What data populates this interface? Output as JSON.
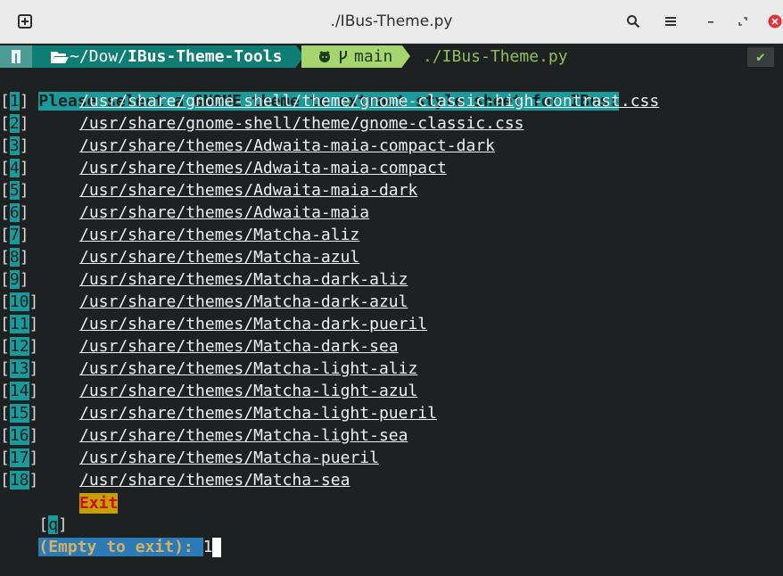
{
  "window": {
    "title": "./IBus-Theme.py",
    "new_tab_icon": "new-tab-icon",
    "search_icon": "search-icon",
    "menu_icon": "hamburger-menu-icon",
    "minimize_icon": "minimize-icon",
    "maximize_icon": "restore-icon",
    "close_icon": "close-icon"
  },
  "prompt": {
    "path_prefix": "~/Dow/",
    "path_bold": "IBus-Theme-Tools",
    "git_icon": "github-icon",
    "branch_icon": "git-branch-icon",
    "branch": "main",
    "command": "./IBus-Theme.py",
    "status": "✔"
  },
  "heading": "Please select a GNOME theme to extract style sheet for IBus:",
  "options": [
    {
      "key": "1",
      "path": "/usr/share/gnome-shell/theme/gnome-classic-high-contrast.css"
    },
    {
      "key": "2",
      "path": "/usr/share/gnome-shell/theme/gnome-classic.css"
    },
    {
      "key": "3",
      "path": "/usr/share/themes/Adwaita-maia-compact-dark"
    },
    {
      "key": "4",
      "path": "/usr/share/themes/Adwaita-maia-compact"
    },
    {
      "key": "5",
      "path": "/usr/share/themes/Adwaita-maia-dark"
    },
    {
      "key": "6",
      "path": "/usr/share/themes/Adwaita-maia"
    },
    {
      "key": "7",
      "path": "/usr/share/themes/Matcha-aliz"
    },
    {
      "key": "8",
      "path": "/usr/share/themes/Matcha-azul"
    },
    {
      "key": "9",
      "path": "/usr/share/themes/Matcha-dark-aliz"
    },
    {
      "key": "10",
      "path": "/usr/share/themes/Matcha-dark-azul"
    },
    {
      "key": "11",
      "path": "/usr/share/themes/Matcha-dark-pueril"
    },
    {
      "key": "12",
      "path": "/usr/share/themes/Matcha-dark-sea"
    },
    {
      "key": "13",
      "path": "/usr/share/themes/Matcha-light-aliz"
    },
    {
      "key": "14",
      "path": "/usr/share/themes/Matcha-light-azul"
    },
    {
      "key": "15",
      "path": "/usr/share/themes/Matcha-light-pueril"
    },
    {
      "key": "16",
      "path": "/usr/share/themes/Matcha-light-sea"
    },
    {
      "key": "17",
      "path": "/usr/share/themes/Matcha-pueril"
    },
    {
      "key": "18",
      "path": "/usr/share/themes/Matcha-sea"
    }
  ],
  "exit_option": {
    "key": "q",
    "label": "Exit"
  },
  "input": {
    "label": "(Empty to exit): ",
    "value": "1"
  },
  "colors": {
    "terminal_bg": "#1e2122",
    "teal_highlight": "#1a9a9a",
    "exit_bg": "#c6a000",
    "exit_text": "#cc1010",
    "input_label_bg": "#2b7bb8",
    "git_segment": "#a6d46e"
  }
}
